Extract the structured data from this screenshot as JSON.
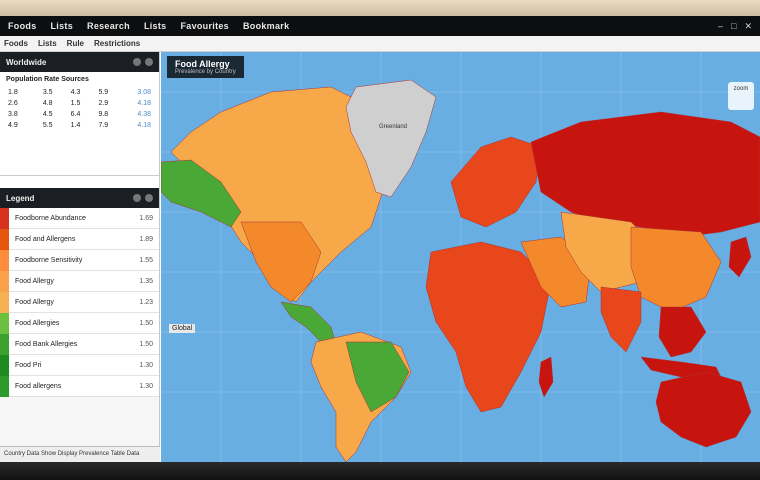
{
  "app": {
    "menu": [
      "Foods",
      "Lists",
      "Research",
      "Lists",
      "Favourites",
      "Bookmark"
    ],
    "toolbar": [
      "Foods",
      "Lists",
      "Rule",
      "Restrictions"
    ]
  },
  "stats_panel": {
    "title": "Worldwide",
    "subtitle": "Population Rate Sources",
    "rows": [
      [
        "1.8",
        "3.5",
        "4.3",
        "5.9",
        "3.08"
      ],
      [
        "2.6",
        "4.8",
        "1.5",
        "2.9",
        "4.18"
      ],
      [
        "3.8",
        "4.5",
        "6.4",
        "9.8",
        "4.38"
      ],
      [
        "4.9",
        "5.5",
        "1.4",
        "7.9",
        "4.18"
      ]
    ]
  },
  "legend_panel": {
    "title": "Legend",
    "items": [
      {
        "label": "Foodborne Abundance",
        "value": "1.69",
        "color": "#d7301f"
      },
      {
        "label": "Food and Allergens",
        "value": "1.89",
        "color": "#e6550d"
      },
      {
        "label": "Foodborne Sensitivity",
        "value": "1.55",
        "color": "#fd8d3c"
      },
      {
        "label": "Food Allergy",
        "value": "1.35",
        "color": "#f9a24a"
      },
      {
        "label": "Food Allergy",
        "value": "1.23",
        "color": "#f7b155"
      },
      {
        "label": "Food Allergies",
        "value": "1.50",
        "color": "#6cbf3f"
      },
      {
        "label": "Food Bank Allergies",
        "value": "1.50",
        "color": "#3ca12e"
      },
      {
        "label": "Food Pri",
        "value": "1.30",
        "color": "#1f8a1f"
      },
      {
        "label": "Food allergens",
        "value": "1.30",
        "color": "#2f9a2c"
      }
    ],
    "footer": "Country  Data Show  Display Prevalence Table Data"
  },
  "map": {
    "title": "Food Allergy",
    "subtitle": "Prevalence by Country",
    "scale_label": "Global",
    "zoom_text": "zoom",
    "labels": [
      "Greenland"
    ],
    "colors": {
      "ocean": "#68aee3",
      "high": "#c8140f",
      "mid_high": "#e8471c",
      "mid": "#f4892b",
      "low_mid": "#f7a94a",
      "low": "#4aa836",
      "none": "#cfcfcf"
    }
  }
}
